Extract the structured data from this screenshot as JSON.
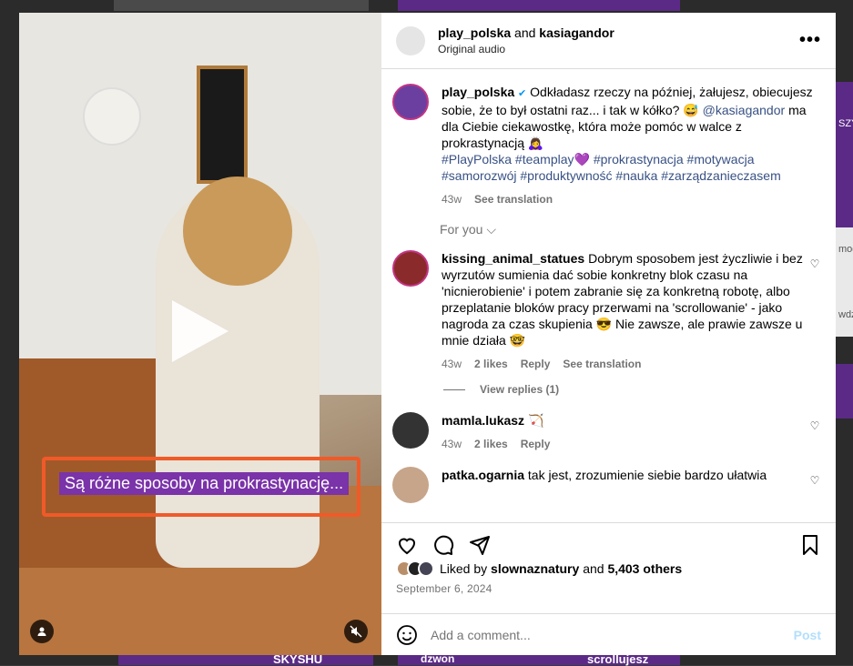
{
  "background": {
    "video_bottom_texts": [
      "SKYSHU",
      "dzwon",
      "scrollujesz"
    ],
    "right_edge_texts": [
      "SZY",
      "mog",
      "wdz"
    ]
  },
  "video": {
    "caption": "Są różne sposoby na prokrastynację...",
    "play_icon": "play-icon",
    "user_icon": "person-icon",
    "mute_icon": "speaker-muted-icon",
    "caption_highlight_color": "#f05a28"
  },
  "header": {
    "user1": "play_polska",
    "and": "and",
    "user2": "kasiagandor",
    "subtitle": "Original audio",
    "more_icon": "•••"
  },
  "caption_post": {
    "username": "play_polska",
    "verified": "✔",
    "text": "Odkładasz rzeczy na później, żałujesz, obiecujesz sobie, że to był ostatni raz... i tak w kółko? 😅",
    "mention": "@kasiagandor",
    "text2": "ma dla Ciebie ciekawostkę, która może pomóc w walce z prokrastynacją 🙇‍♀️",
    "hashtags_line1": "#PlayPolska #teamplay💜 #prokrastynacja #motywacja",
    "hashtags_line2": "#samorozwój #produktywność #nauka #zarządzanieczasem",
    "time": "43w",
    "see_translation": "See translation"
  },
  "for_you": "For you ⌵",
  "comments": [
    {
      "username": "kissing_animal_statues",
      "text": "Dobrym sposobem jest życzliwie i bez wyrzutów sumienia dać sobie konkretny blok czasu na 'nicnierobienie' i potem zabranie się za konkretną robotę, albo przeplatanie bloków pracy przerwami na 'scrollowanie' - jako nagroda za czas skupienia 😎 Nie zawsze, ale prawie zawsze u mnie działa 🤓",
      "time": "43w",
      "likes": "2 likes",
      "reply": "Reply",
      "see_translation": "See translation",
      "view_replies": "View replies (1)"
    },
    {
      "username": "mamla.lukasz",
      "text": "🏹",
      "time": "43w",
      "likes": "2 likes",
      "reply": "Reply"
    },
    {
      "username": "patka.ogarnia",
      "text": "tak jest, zrozumienie siebie bardzo ułatwia"
    }
  ],
  "actions": {
    "like_icon": "heart-icon",
    "comment_icon": "comment-icon",
    "share_icon": "send-icon",
    "save_icon": "bookmark-icon"
  },
  "liked_by": {
    "prefix": "Liked by",
    "user": "slownaznatury",
    "and": "and",
    "others": "5,403 others"
  },
  "date": "September 6, 2024",
  "add_comment": {
    "placeholder": "Add a comment...",
    "post": "Post",
    "emoji_icon": "smile-icon"
  }
}
